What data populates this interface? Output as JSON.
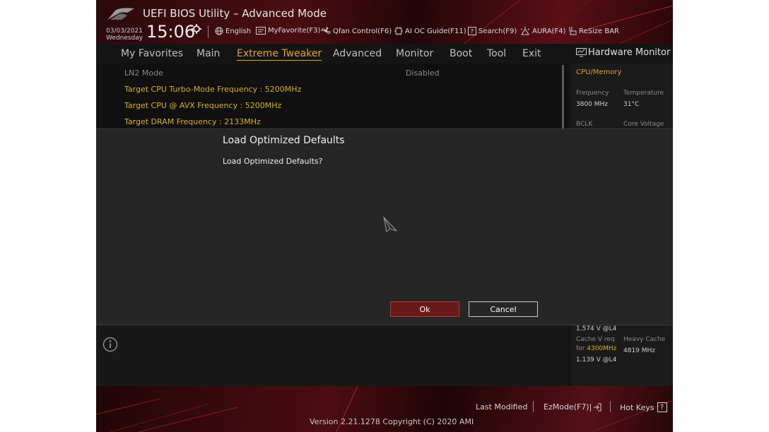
{
  "title": "UEFI BIOS Utility – Advanced Mode",
  "datetime": {
    "date": "03/03/2021",
    "day": "Wednesday",
    "time": "15:06"
  },
  "toolbar": [
    {
      "icon": "globe-icon",
      "label": "English"
    },
    {
      "icon": "favorite-icon",
      "label": "MyFavorite(F3)"
    },
    {
      "icon": "fan-icon",
      "label": "Qfan Control(F6)"
    },
    {
      "icon": "ai-oc-icon",
      "label": "AI OC Guide(F11)"
    },
    {
      "icon": "question-icon",
      "label": "Search(F9)"
    },
    {
      "icon": "aura-icon",
      "label": "AURA(F4)"
    },
    {
      "icon": "resize-bar-icon",
      "label": "ReSize BAR"
    }
  ],
  "nav": [
    {
      "label": "My Favorites",
      "active": false
    },
    {
      "label": "Main",
      "active": false
    },
    {
      "label": "Extreme Tweaker",
      "active": true
    },
    {
      "label": "Advanced",
      "active": false
    },
    {
      "label": "Monitor",
      "active": false
    },
    {
      "label": "Boot",
      "active": false
    },
    {
      "label": "Tool",
      "active": false
    },
    {
      "label": "Exit",
      "active": false
    }
  ],
  "settings": [
    {
      "label": "LN2 Mode",
      "value": "Disabled"
    },
    {
      "label": "Target CPU Turbo-Mode Frequency : 5200MHz"
    },
    {
      "label": "Target CPU @ AVX Frequency : 5200MHz"
    },
    {
      "label": "Target DRAM Frequency : 2133MHz"
    }
  ],
  "hw_monitor": {
    "title": "Hardware Monitor",
    "section": "CPU/Memory",
    "frequency_label": "Frequency",
    "frequency_value": "3800 MHz",
    "temperature_label": "Temperature",
    "temperature_value": "31°C",
    "bclk_label": "BCLK",
    "core_voltage_label": "Core Voltage",
    "voltage_l4": "1.574 V @L4",
    "cache_v_req_label": "Cache V req",
    "cache_for_label": "for",
    "cache_for_freq": "4300MHz",
    "heavy_cache_label": "Heavy Cache",
    "heavy_cache_value": "4819 MHz",
    "cache_voltage": "1.139 V @L4"
  },
  "dialog": {
    "title": "Load Optimized Defaults",
    "message": "Load Optimized Defaults?",
    "ok_label": "Ok",
    "cancel_label": "Cancel"
  },
  "footer": {
    "last_modified": "Last Modified",
    "ezmode": "EzMode(F7)|",
    "hotkeys": "Hot Keys",
    "hotkeys_key": "?",
    "version": "Version 2.21.1278 Copyright (C) 2020 AMI"
  },
  "colors": {
    "accent_yellow": "#d4b02a",
    "accent_orange": "#e2a52b",
    "ok_button": "#6b1a1a",
    "dialog_bg": "#262626"
  }
}
